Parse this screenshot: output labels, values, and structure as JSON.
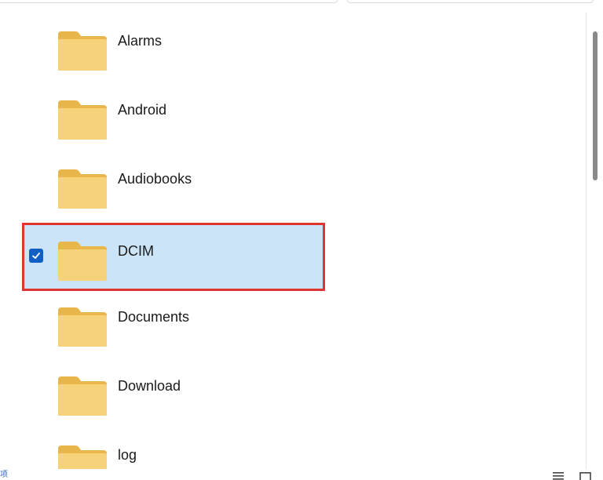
{
  "folders": [
    {
      "label": "Alarms",
      "selected": false
    },
    {
      "label": "Android",
      "selected": false
    },
    {
      "label": "Audiobooks",
      "selected": false
    },
    {
      "label": "DCIM",
      "selected": true
    },
    {
      "label": "Documents",
      "selected": false
    },
    {
      "label": "Download",
      "selected": false
    },
    {
      "label": "log",
      "selected": false
    }
  ],
  "status": {
    "text": "项"
  },
  "colors": {
    "selection_bg": "#cce4f7",
    "highlight_border": "#e03531",
    "checkbox_fill": "#0f5fc7",
    "folder_body": "#f6d27a",
    "folder_tab": "#e8b64a"
  },
  "icons": {
    "folder": "folder-icon",
    "check": "checkmark-icon",
    "list_view": "list-view-icon",
    "tiles_view": "tiles-view-icon"
  }
}
